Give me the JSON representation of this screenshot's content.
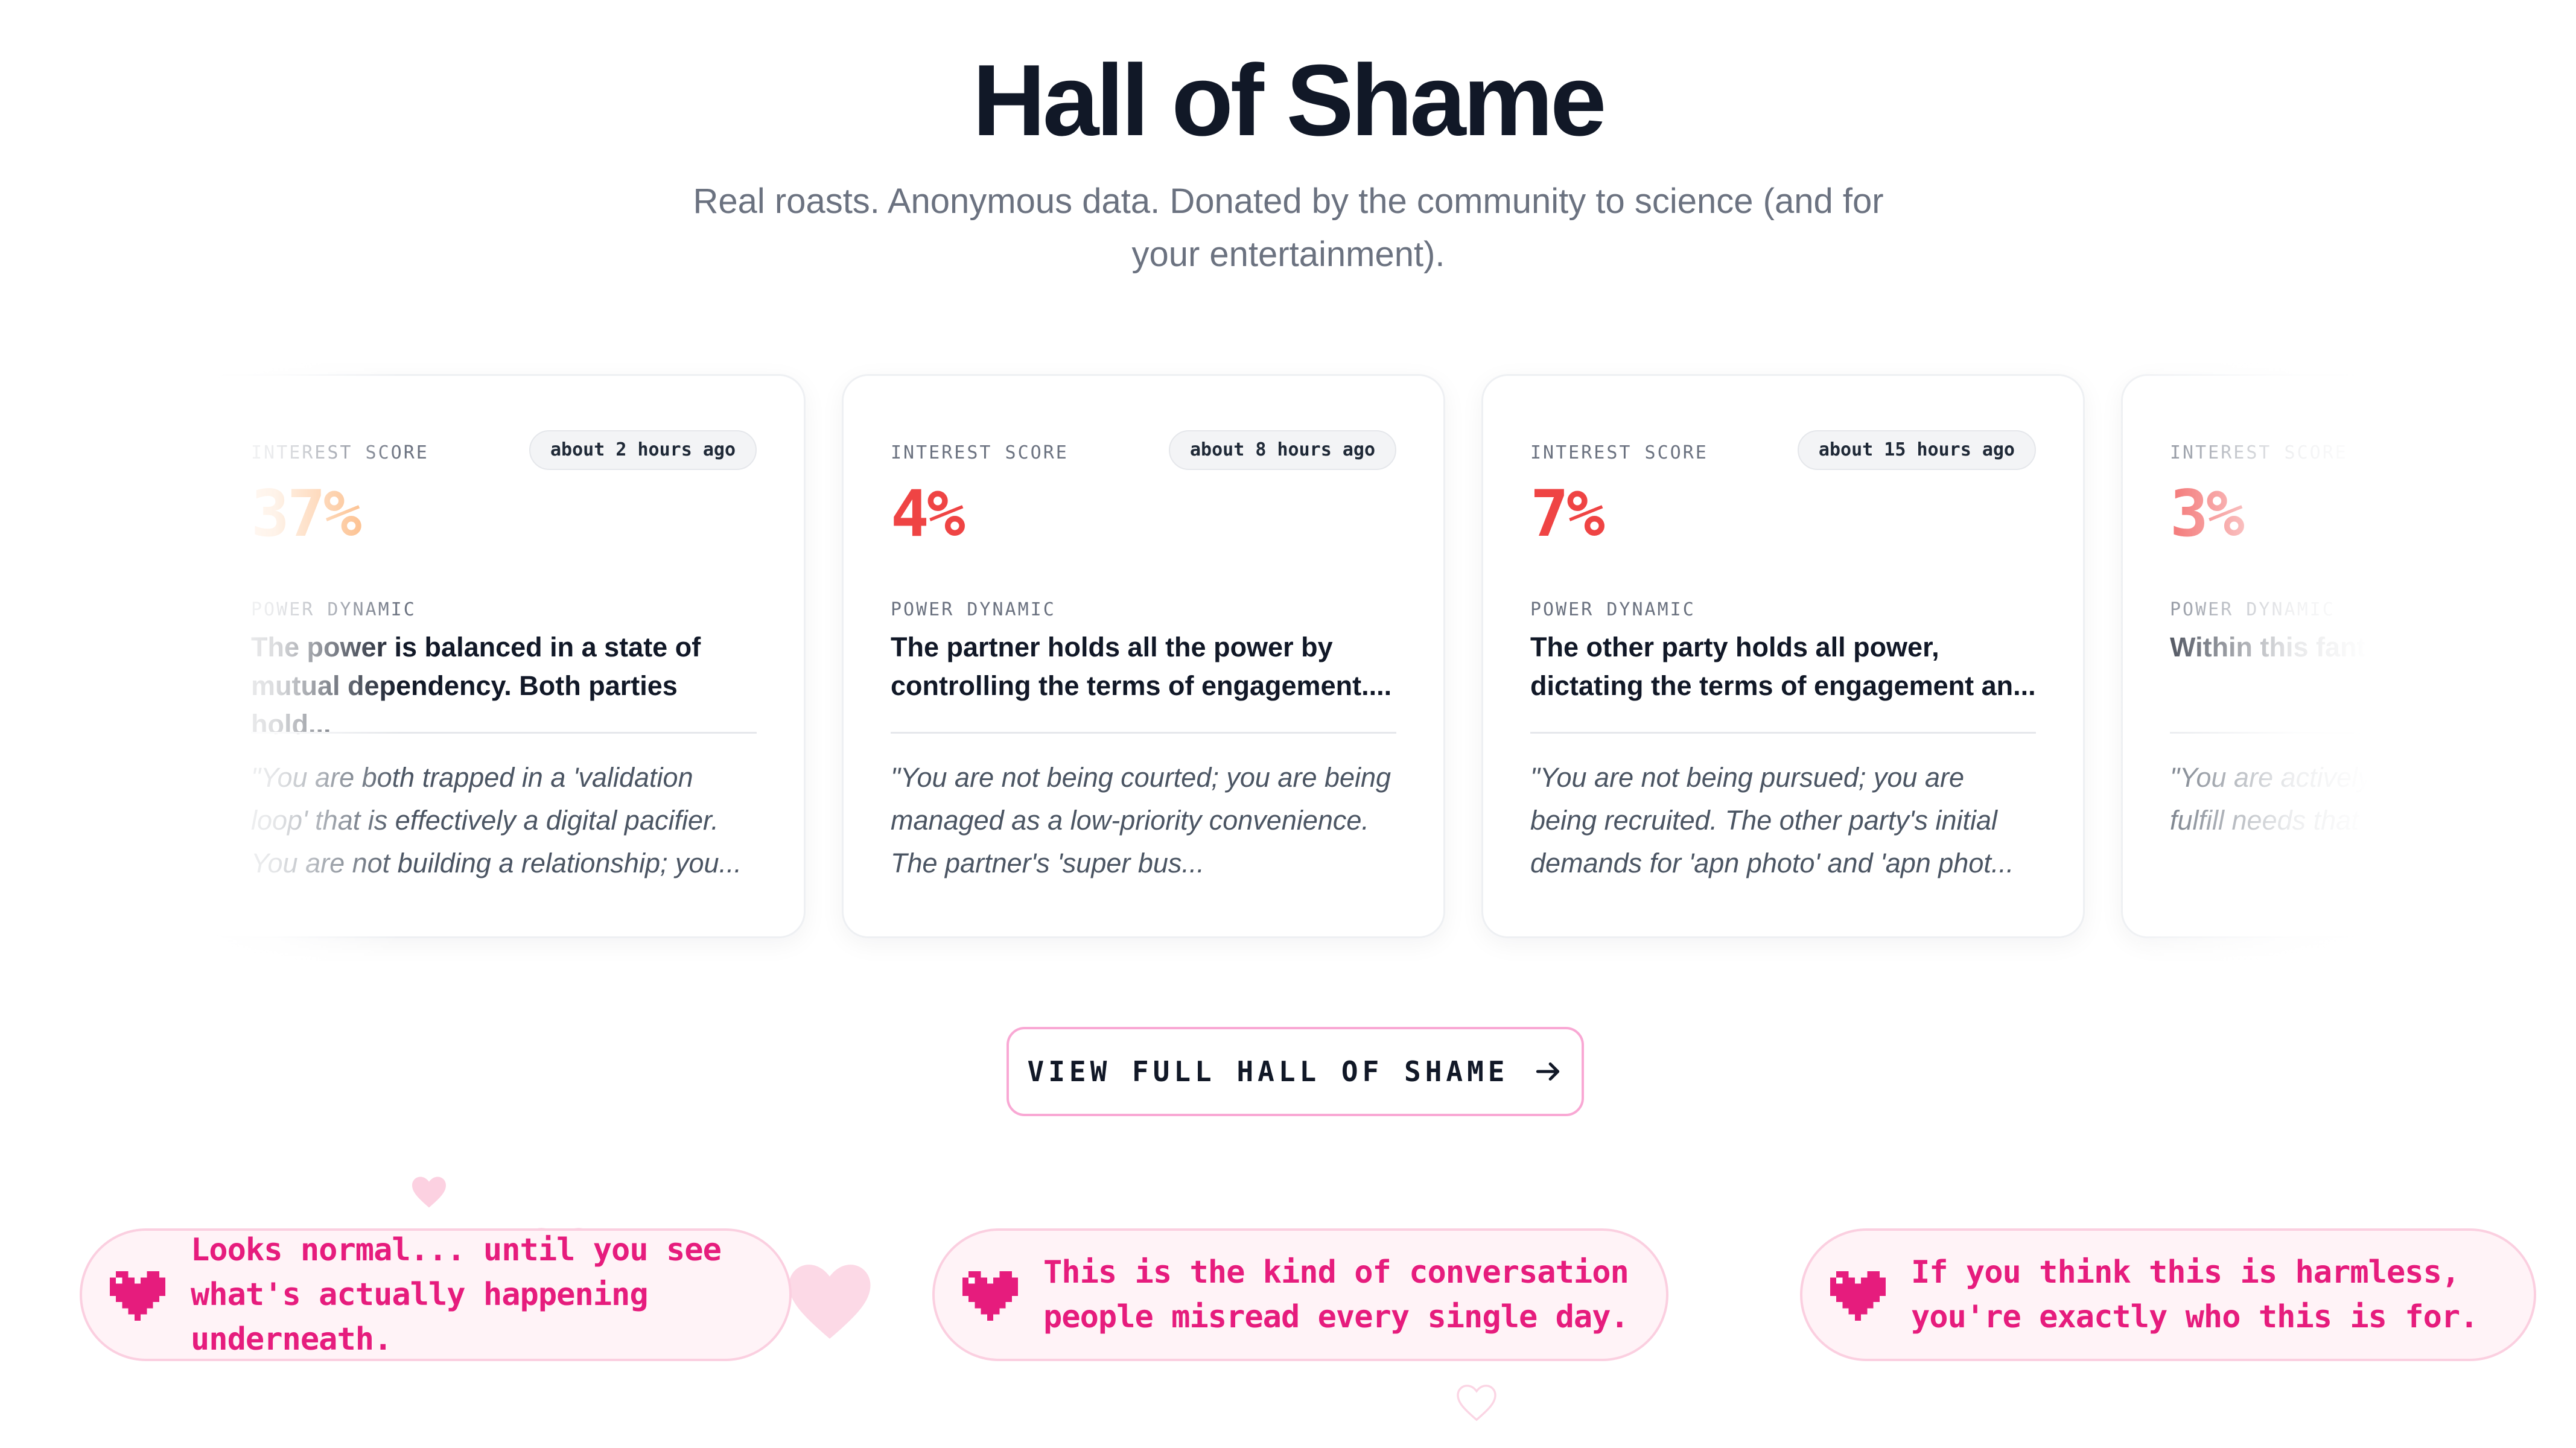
{
  "header": {
    "title": "Hall of Shame",
    "subtitle": "Real roasts. Anonymous data. Donated by the community to science (and for your entertainment)."
  },
  "cards": [
    {
      "interest_label": "INTEREST SCORE",
      "score": "37%",
      "time_ago": "about 2 hours ago",
      "power_label": "POWER DYNAMIC",
      "power_text": "The power is balanced in a state of mutual dependency. Both parties hold...",
      "quote": "\"You are both trapped in a 'validation loop' that is effectively a digital pacifier. You are not building a relationship; you..."
    },
    {
      "interest_label": "INTEREST SCORE",
      "score": "4%",
      "time_ago": "about 8 hours ago",
      "power_label": "POWER DYNAMIC",
      "power_text": "The partner holds all the power by controlling the terms of engagement....",
      "quote": "\"You are not being courted; you are being managed as a low-priority convenience. The partner's 'super bus..."
    },
    {
      "interest_label": "INTEREST SCORE",
      "score": "7%",
      "time_ago": "about 15 hours ago",
      "power_label": "POWER DYNAMIC",
      "power_text": "The other party holds all power, dictating the terms of engagement an...",
      "quote": "\"You are not being pursued; you are being recruited. The other party's initial demands for 'apn photo' and 'apn phot..."
    },
    {
      "interest_label": "INTEREST SCORE",
      "score": "3%",
      "power_label": "POWER DYNAMIC",
      "power_text": "Within this fantasy constructed and s",
      "quote": "\"You are actively c idealized, sexually fulfill needs that a"
    }
  ],
  "cta": {
    "label": "VIEW FULL HALL OF SHAME",
    "icon": "arrow-right-icon"
  },
  "callouts": [
    {
      "icon": "pixel-heart-icon",
      "text": "Looks normal... until you see what's actually happening underneath."
    },
    {
      "icon": "pixel-heart-icon",
      "text": "This is the kind of conversation people misread every single day."
    },
    {
      "icon": "pixel-heart-icon",
      "text": "If you think this is harmless, you're exactly who this is for."
    }
  ],
  "colors": {
    "score_red": "#ef4444",
    "score_orange": "#fb923c",
    "accent_pink": "#e61c7d",
    "pill_bg": "#fff3f7",
    "pill_border": "#fbcfe0"
  }
}
